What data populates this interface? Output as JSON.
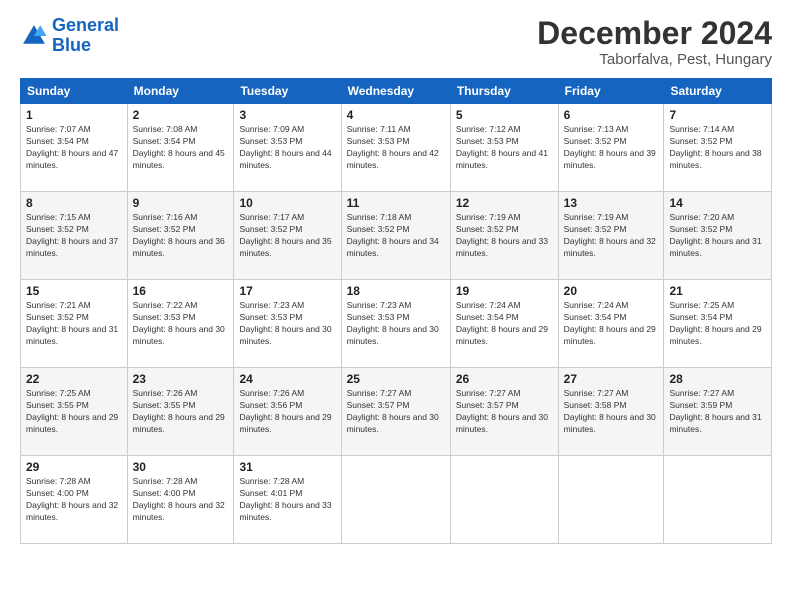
{
  "header": {
    "logo_line1": "General",
    "logo_line2": "Blue",
    "title": "December 2024",
    "subtitle": "Taborfalva, Pest, Hungary"
  },
  "days_of_week": [
    "Sunday",
    "Monday",
    "Tuesday",
    "Wednesday",
    "Thursday",
    "Friday",
    "Saturday"
  ],
  "weeks": [
    [
      {
        "day": "1",
        "sunrise": "7:07 AM",
        "sunset": "3:54 PM",
        "daylight": "8 hours and 47 minutes."
      },
      {
        "day": "2",
        "sunrise": "7:08 AM",
        "sunset": "3:54 PM",
        "daylight": "8 hours and 45 minutes."
      },
      {
        "day": "3",
        "sunrise": "7:09 AM",
        "sunset": "3:53 PM",
        "daylight": "8 hours and 44 minutes."
      },
      {
        "day": "4",
        "sunrise": "7:11 AM",
        "sunset": "3:53 PM",
        "daylight": "8 hours and 42 minutes."
      },
      {
        "day": "5",
        "sunrise": "7:12 AM",
        "sunset": "3:53 PM",
        "daylight": "8 hours and 41 minutes."
      },
      {
        "day": "6",
        "sunrise": "7:13 AM",
        "sunset": "3:52 PM",
        "daylight": "8 hours and 39 minutes."
      },
      {
        "day": "7",
        "sunrise": "7:14 AM",
        "sunset": "3:52 PM",
        "daylight": "8 hours and 38 minutes."
      }
    ],
    [
      {
        "day": "8",
        "sunrise": "7:15 AM",
        "sunset": "3:52 PM",
        "daylight": "8 hours and 37 minutes."
      },
      {
        "day": "9",
        "sunrise": "7:16 AM",
        "sunset": "3:52 PM",
        "daylight": "8 hours and 36 minutes."
      },
      {
        "day": "10",
        "sunrise": "7:17 AM",
        "sunset": "3:52 PM",
        "daylight": "8 hours and 35 minutes."
      },
      {
        "day": "11",
        "sunrise": "7:18 AM",
        "sunset": "3:52 PM",
        "daylight": "8 hours and 34 minutes."
      },
      {
        "day": "12",
        "sunrise": "7:19 AM",
        "sunset": "3:52 PM",
        "daylight": "8 hours and 33 minutes."
      },
      {
        "day": "13",
        "sunrise": "7:19 AM",
        "sunset": "3:52 PM",
        "daylight": "8 hours and 32 minutes."
      },
      {
        "day": "14",
        "sunrise": "7:20 AM",
        "sunset": "3:52 PM",
        "daylight": "8 hours and 31 minutes."
      }
    ],
    [
      {
        "day": "15",
        "sunrise": "7:21 AM",
        "sunset": "3:52 PM",
        "daylight": "8 hours and 31 minutes."
      },
      {
        "day": "16",
        "sunrise": "7:22 AM",
        "sunset": "3:53 PM",
        "daylight": "8 hours and 30 minutes."
      },
      {
        "day": "17",
        "sunrise": "7:23 AM",
        "sunset": "3:53 PM",
        "daylight": "8 hours and 30 minutes."
      },
      {
        "day": "18",
        "sunrise": "7:23 AM",
        "sunset": "3:53 PM",
        "daylight": "8 hours and 30 minutes."
      },
      {
        "day": "19",
        "sunrise": "7:24 AM",
        "sunset": "3:54 PM",
        "daylight": "8 hours and 29 minutes."
      },
      {
        "day": "20",
        "sunrise": "7:24 AM",
        "sunset": "3:54 PM",
        "daylight": "8 hours and 29 minutes."
      },
      {
        "day": "21",
        "sunrise": "7:25 AM",
        "sunset": "3:54 PM",
        "daylight": "8 hours and 29 minutes."
      }
    ],
    [
      {
        "day": "22",
        "sunrise": "7:25 AM",
        "sunset": "3:55 PM",
        "daylight": "8 hours and 29 minutes."
      },
      {
        "day": "23",
        "sunrise": "7:26 AM",
        "sunset": "3:55 PM",
        "daylight": "8 hours and 29 minutes."
      },
      {
        "day": "24",
        "sunrise": "7:26 AM",
        "sunset": "3:56 PM",
        "daylight": "8 hours and 29 minutes."
      },
      {
        "day": "25",
        "sunrise": "7:27 AM",
        "sunset": "3:57 PM",
        "daylight": "8 hours and 30 minutes."
      },
      {
        "day": "26",
        "sunrise": "7:27 AM",
        "sunset": "3:57 PM",
        "daylight": "8 hours and 30 minutes."
      },
      {
        "day": "27",
        "sunrise": "7:27 AM",
        "sunset": "3:58 PM",
        "daylight": "8 hours and 30 minutes."
      },
      {
        "day": "28",
        "sunrise": "7:27 AM",
        "sunset": "3:59 PM",
        "daylight": "8 hours and 31 minutes."
      }
    ],
    [
      {
        "day": "29",
        "sunrise": "7:28 AM",
        "sunset": "4:00 PM",
        "daylight": "8 hours and 32 minutes."
      },
      {
        "day": "30",
        "sunrise": "7:28 AM",
        "sunset": "4:00 PM",
        "daylight": "8 hours and 32 minutes."
      },
      {
        "day": "31",
        "sunrise": "7:28 AM",
        "sunset": "4:01 PM",
        "daylight": "8 hours and 33 minutes."
      },
      null,
      null,
      null,
      null
    ]
  ],
  "labels": {
    "sunrise": "Sunrise:",
    "sunset": "Sunset:",
    "daylight": "Daylight:"
  }
}
